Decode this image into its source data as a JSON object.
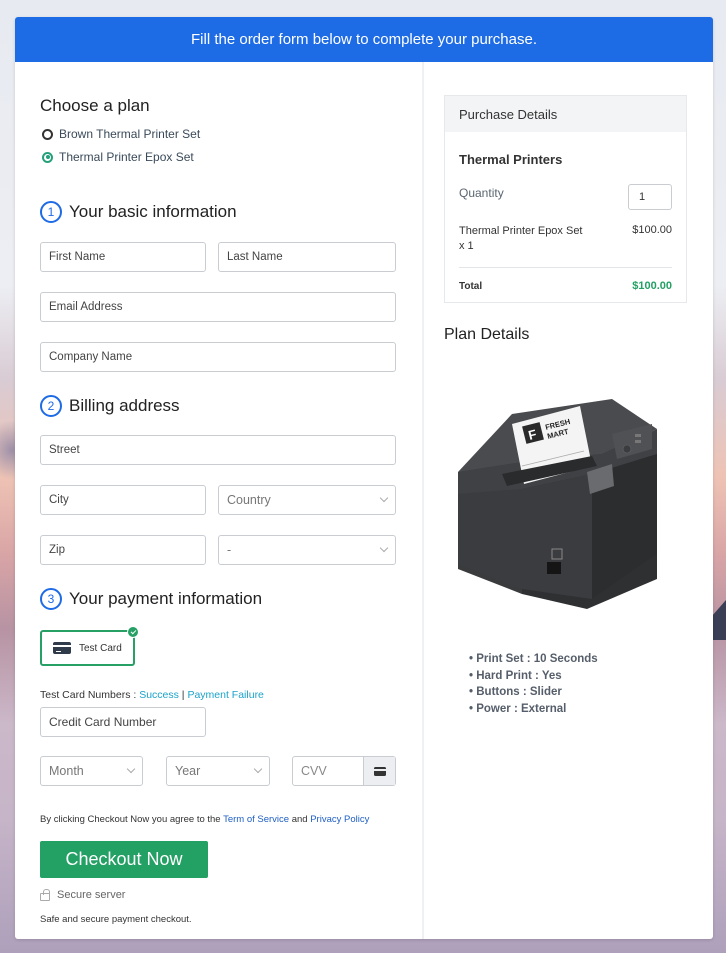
{
  "banner": {
    "text": "Fill the order form below to complete your purchase."
  },
  "plan": {
    "heading": "Choose a plan",
    "options": [
      {
        "label": "Brown Thermal Printer Set",
        "selected": false
      },
      {
        "label": "Thermal Printer Epox Set",
        "selected": true
      }
    ]
  },
  "basic_info": {
    "step": "1",
    "heading": "Your basic information",
    "first_name_placeholder": "First Name",
    "last_name_placeholder": "Last Name",
    "email_placeholder": "Email Address",
    "company_placeholder": "Company Name"
  },
  "billing": {
    "step": "2",
    "heading": "Billing address",
    "street_placeholder": "Street",
    "city_placeholder": "City",
    "country_selected": "Country",
    "zip_placeholder": "Zip",
    "state_selected": "-"
  },
  "payment": {
    "step": "3",
    "heading": "Your payment information",
    "method_label": "Test Card",
    "test_numbers_label": "Test Card Numbers : ",
    "success_link": "Success",
    "separator": " | ",
    "failure_link": "Payment Failure",
    "card_number_placeholder": "Credit Card Number",
    "month_selected": "Month",
    "year_selected": "Year",
    "cvv_placeholder": "CVV"
  },
  "agreement": {
    "prefix": "By clicking Checkout Now you agree to the ",
    "tos_link": "Term of Service",
    "and": " and ",
    "privacy_link": "Privacy Policy"
  },
  "checkout": {
    "button_label": "Checkout Now",
    "secure_label": "Secure server",
    "safe_text": "Safe and secure payment checkout."
  },
  "purchase_details": {
    "heading": "Purchase Details",
    "product_title": "Thermal Printers",
    "quantity_label": "Quantity",
    "quantity_value": "1",
    "item_name": "Thermal Printer Epox Set",
    "item_qty": "x 1",
    "item_price": "$100.00",
    "total_label": "Total",
    "total_value": "$100.00"
  },
  "plan_details": {
    "heading": "Plan Details",
    "image_brand": {
      "line1": "FRESH",
      "line2": "MART",
      "logo_letter": "F"
    },
    "features": [
      "Print Set : 10 Seconds",
      "Hard Print : Yes",
      "Buttons : Slider",
      "Power : External"
    ]
  },
  "colors": {
    "banner_blue": "#1e6be6",
    "accent_green": "#23a064",
    "link_teal": "#1aa3c9"
  }
}
